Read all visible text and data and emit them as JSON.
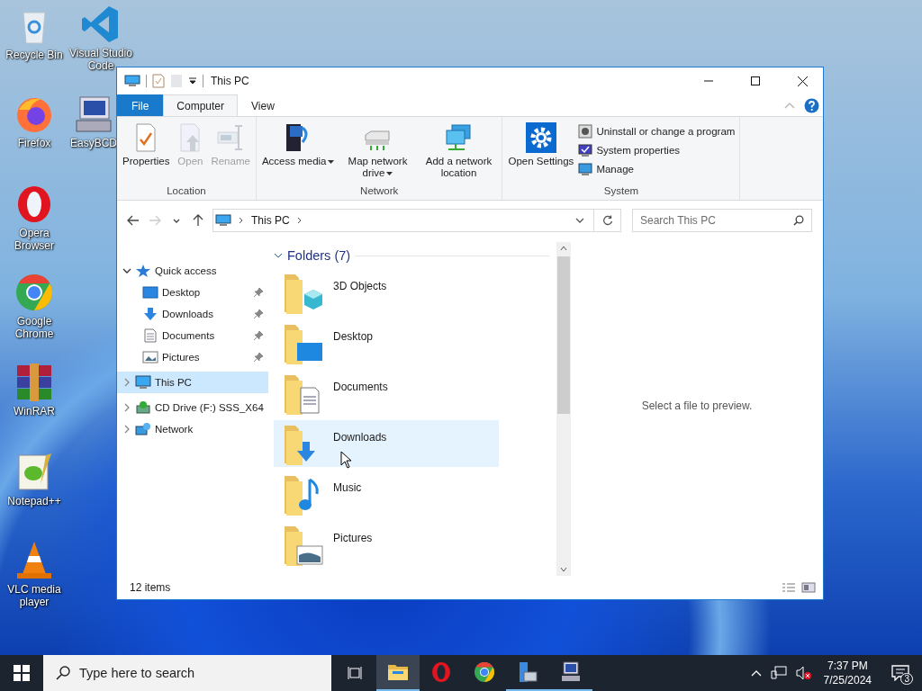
{
  "desktop_icons": [
    {
      "label": "Recycle Bin",
      "kind": "recycle"
    },
    {
      "label": "Visual Studio Code",
      "kind": "vscode"
    },
    {
      "label": "Firefox",
      "kind": "firefox"
    },
    {
      "label": "EasyBCD",
      "kind": "easybcd"
    },
    {
      "label": "Opera Browser",
      "kind": "opera"
    },
    {
      "label": "Google Chrome",
      "kind": "chrome"
    },
    {
      "label": "WinRAR",
      "kind": "winrar"
    },
    {
      "label": "Notepad++",
      "kind": "notepad"
    },
    {
      "label": "VLC media player",
      "kind": "vlc"
    }
  ],
  "window": {
    "title": "This PC"
  },
  "ribbon_tabs": [
    {
      "label": "File",
      "kind": "file",
      "selected": false
    },
    {
      "label": "Computer",
      "kind": "tab",
      "selected": true
    },
    {
      "label": "View",
      "kind": "tab",
      "selected": false
    }
  ],
  "ribbon_groups": [
    {
      "label": "Location",
      "items": [
        {
          "label": "Properties",
          "kind": "properties",
          "disabled": false,
          "dropdown": false
        },
        {
          "label": "Open",
          "kind": "open",
          "disabled": true,
          "dropdown": false
        },
        {
          "label": "Rename",
          "kind": "rename",
          "disabled": true,
          "dropdown": false
        }
      ]
    },
    {
      "label": "Network",
      "items": [
        {
          "label": "Access media",
          "kind": "media",
          "disabled": false,
          "dropdown": true
        },
        {
          "label": "Map network drive",
          "kind": "mapdrive",
          "disabled": false,
          "dropdown": true
        },
        {
          "label": "Add a network location",
          "kind": "netloc",
          "disabled": false,
          "dropdown": false
        }
      ]
    },
    {
      "label": "System",
      "items": [
        {
          "label": "Open Settings",
          "kind": "settings",
          "disabled": false,
          "dropdown": false
        }
      ],
      "small_items": [
        {
          "label": "Uninstall or change a program",
          "kind": "uninstall"
        },
        {
          "label": "System properties",
          "kind": "sysprops"
        },
        {
          "label": "Manage",
          "kind": "manage"
        }
      ]
    }
  ],
  "nav_buttons": [
    {
      "kind": "back",
      "disabled": false
    },
    {
      "kind": "forward",
      "disabled": true
    },
    {
      "kind": "recent",
      "disabled": false
    },
    {
      "kind": "up",
      "disabled": false
    }
  ],
  "address_bar": {
    "path": "This PC"
  },
  "search": {
    "placeholder": "Search This PC"
  },
  "nav_pane": [
    {
      "label": "Quick access",
      "kind": "quick",
      "expanded": true,
      "selected": false,
      "children": [
        {
          "label": "Desktop",
          "kind": "desktop",
          "pinned": true,
          "selected": false
        },
        {
          "label": "Downloads",
          "kind": "downloads",
          "pinned": true,
          "selected": false
        },
        {
          "label": "Documents",
          "kind": "documents",
          "pinned": true,
          "selected": false
        },
        {
          "label": "Pictures",
          "kind": "pictures",
          "pinned": true,
          "selected": false
        }
      ]
    },
    {
      "label": "This PC",
      "kind": "pc",
      "expanded": false,
      "selected": true
    },
    {
      "label": "CD Drive (F:) SSS_X64",
      "kind": "cd",
      "expanded": false,
      "selected": false
    },
    {
      "label": "Network",
      "kind": "network",
      "expanded": false,
      "selected": false
    }
  ],
  "content": {
    "group": {
      "label": "Folders (7)",
      "expanded": true
    },
    "folders": [
      {
        "label": "3D Objects",
        "kind": "objects",
        "selected": false
      },
      {
        "label": "Desktop",
        "kind": "desktop",
        "selected": false
      },
      {
        "label": "Documents",
        "kind": "documents",
        "selected": false
      },
      {
        "label": "Downloads",
        "kind": "downloads",
        "selected": true
      },
      {
        "label": "Music",
        "kind": "music",
        "selected": false
      },
      {
        "label": "Pictures",
        "kind": "pictures",
        "selected": false
      }
    ]
  },
  "preview": {
    "message": "Select a file to preview."
  },
  "status_bar": {
    "item_count": "12 items"
  },
  "taskbar": {
    "search": {
      "placeholder": "Type here to search"
    },
    "apps": [
      {
        "kind": "explorer",
        "active": true,
        "running": true
      },
      {
        "kind": "opera",
        "active": false,
        "running": false
      },
      {
        "kind": "chrome",
        "active": false,
        "running": false
      },
      {
        "kind": "server",
        "active": false,
        "running": true
      },
      {
        "kind": "computer",
        "active": false,
        "running": true
      }
    ],
    "clock": {
      "time": "7:37 PM",
      "date": "7/25/2024"
    },
    "notification_count": "3"
  }
}
